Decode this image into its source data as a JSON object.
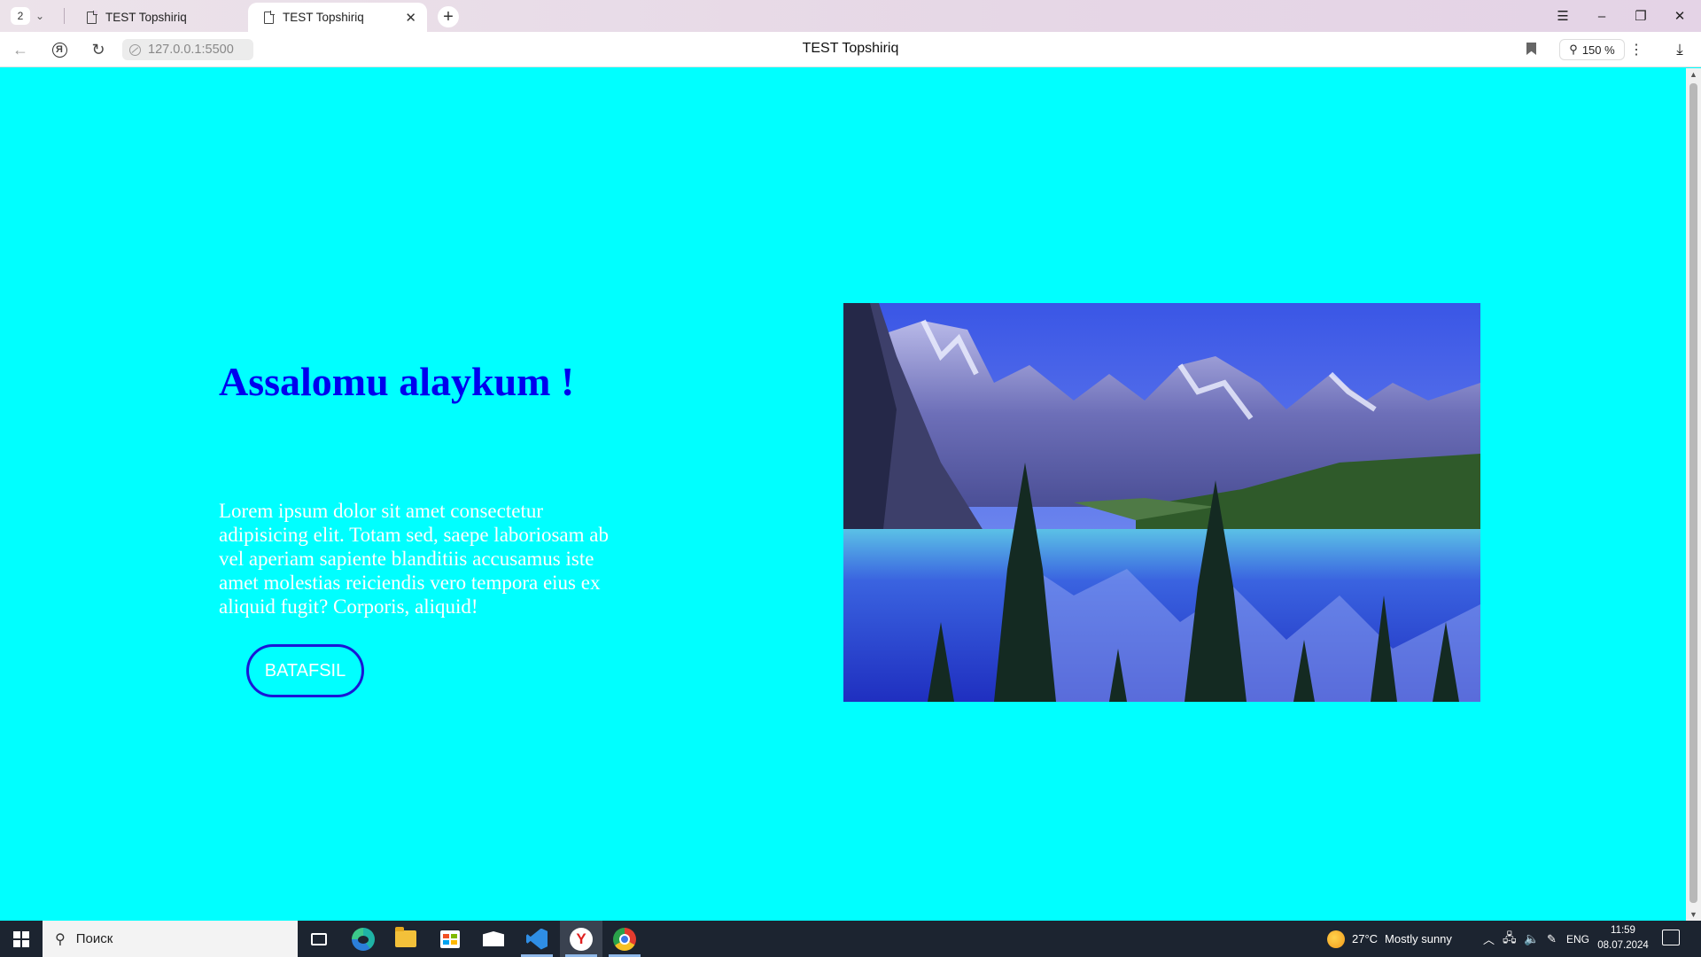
{
  "browser": {
    "tab_count": "2",
    "tabs": [
      {
        "label": "TEST Topshiriq"
      },
      {
        "label": "TEST Topshiriq"
      }
    ],
    "url": "127.0.0.1:5500",
    "page_title": "TEST Topshiriq",
    "zoom": "150 %"
  },
  "page": {
    "background_color": "#00ffff",
    "title": "Assalomu alaykum !",
    "paragraph": "Lorem ipsum dolor sit amet consectetur adipisicing elit. Totam sed, saepe laboriosam ab vel aperiam sapiente blanditiis accusamus iste amet molestias reiciendis vero tempora eius ex aliquid fugit? Corporis, aliquid!",
    "button_label": "BATAFSIL",
    "title_color": "#0000ee",
    "image_name": "mountain-lake-image"
  },
  "taskbar": {
    "search_placeholder": "Поиск",
    "weather_temp": "27°C",
    "weather_text": "Mostly sunny",
    "lang": "ENG",
    "time": "11:59",
    "date": "08.07.2024"
  }
}
